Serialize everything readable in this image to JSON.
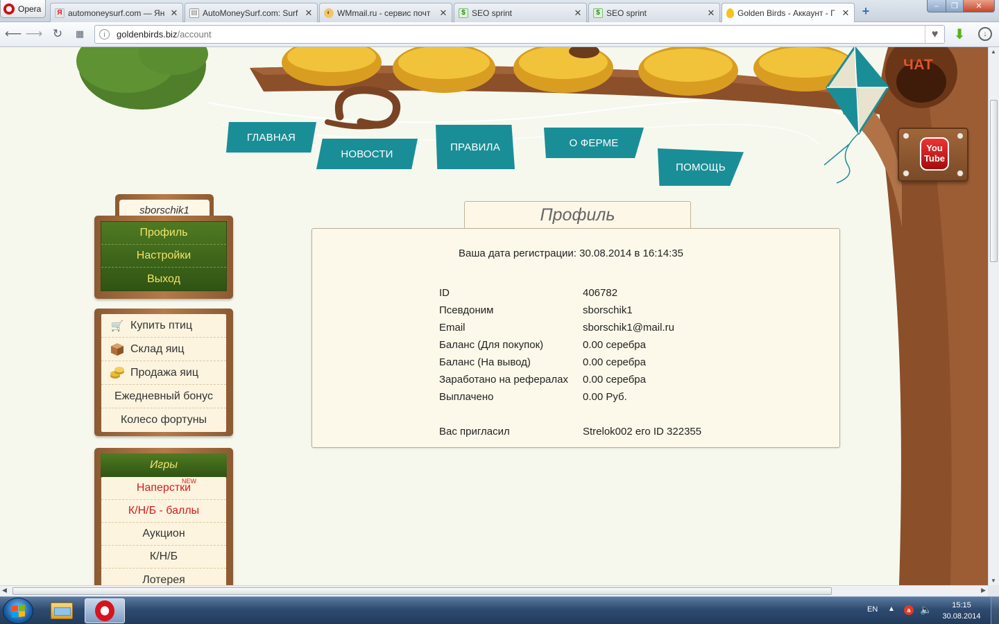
{
  "browser": {
    "menu_label": "Opera",
    "tabs": [
      {
        "title": "automoneysurf.com — Ян",
        "favicon": "yandex-icon",
        "active": false
      },
      {
        "title": "AutoMoneySurf.com: Surf",
        "favicon": "page-icon",
        "active": false
      },
      {
        "title": "WMmail.ru - сервис почт",
        "favicon": "wmmail-icon",
        "active": false
      },
      {
        "title": "SEO sprint",
        "favicon": "seosprint-icon",
        "active": false
      },
      {
        "title": "SEO sprint",
        "favicon": "seosprint-icon",
        "active": false
      },
      {
        "title": "Golden Birds - Аккаунт - Г",
        "favicon": "egg-icon",
        "active": true
      }
    ],
    "new_tab_symbol": "+",
    "window_controls": {
      "minimize": "‒",
      "maximize": "❐",
      "close": "✕"
    },
    "address": {
      "host": "goldenbirds.biz",
      "path": "/account"
    }
  },
  "site": {
    "nav": {
      "main": "ГЛАВНАЯ",
      "news": "НОВОСТИ",
      "rules": "ПРАВИЛА",
      "farm": "О ФЕРМЕ",
      "help": "ПОМОЩЬ"
    },
    "chat_label": "ЧАТ",
    "youtube": {
      "line1": "You",
      "line2": "Tube"
    },
    "username": "sborschik1",
    "account_menu": [
      "Профиль",
      "Настройки",
      "Выход"
    ],
    "shop_menu": [
      {
        "label": "Купить птиц",
        "icon": "cart-icon"
      },
      {
        "label": "Склад яиц",
        "icon": "box-icon"
      },
      {
        "label": "Продажа яиц",
        "icon": "coins-icon"
      },
      {
        "label": "Ежедневный бонус",
        "icon": ""
      },
      {
        "label": "Колесо фортуны",
        "icon": ""
      }
    ],
    "games": {
      "title": "Игры",
      "items": [
        {
          "label": "Наперстки",
          "badge": "NEW",
          "highlight": true
        },
        {
          "label": "К/Н/Б - баллы",
          "highlight": true
        },
        {
          "label": "Аукцион",
          "highlight": false
        },
        {
          "label": "К/Н/Б",
          "highlight": false
        },
        {
          "label": "Лотерея",
          "highlight": false
        }
      ]
    },
    "profile": {
      "title": "Профиль",
      "reg_label": "Ваша дата регистрации:",
      "reg_value": "30.08.2014 в 16:14:35",
      "rows": [
        {
          "label": "ID",
          "value": "406782"
        },
        {
          "label": "Псевдоним",
          "value": "sborschik1"
        },
        {
          "label": "Email",
          "value": "sborschik1@mail.ru"
        },
        {
          "label": "Баланс (Для покупок)",
          "value": "0.00 серебра"
        },
        {
          "label": "Баланс (На вывод)",
          "value": "0.00 серебра"
        },
        {
          "label": "Заработано на рефералах",
          "value": "0.00 серебра"
        },
        {
          "label": "Выплачено",
          "value": "0.00 Руб."
        }
      ],
      "invited_label": "Вас пригласил",
      "invited_value": "Strelok002 его ID 322355"
    }
  },
  "taskbar": {
    "language": "EN",
    "time": "15:15",
    "date": "30.08.2014"
  },
  "colors": {
    "nav_flag": "#1a8e97",
    "menu_green": "#3f6a1b",
    "menu_text_yellow": "#f3e46a",
    "highlight_red": "#d41c1c",
    "chat_orange": "#e2552a"
  }
}
